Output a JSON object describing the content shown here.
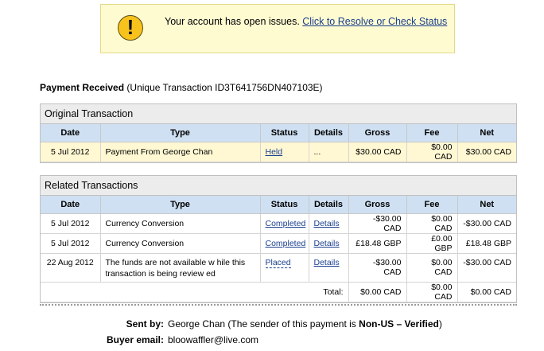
{
  "alert": {
    "icon": "exclamation-icon",
    "message": "Your account has open issues.",
    "link": "Click to Resolve or Check Status"
  },
  "heading": {
    "label": "Payment Received",
    "transaction": "(Unique Transaction ID3T641756DN407103E)"
  },
  "columns": [
    "Date",
    "Type",
    "Status",
    "Details",
    "Gross",
    "Fee",
    "Net"
  ],
  "original": {
    "title": "Original Transaction",
    "row": {
      "date": "5 Jul 2012",
      "type": "Payment From George Chan",
      "status": "Held",
      "details": "...",
      "gross": "$30.00 CAD",
      "fee": "$0.00 CAD",
      "net": "$30.00 CAD"
    }
  },
  "related": {
    "title": "Related Transactions",
    "rows": [
      {
        "date": "5 Jul 2012",
        "type": "Currency Conversion",
        "status": "Completed",
        "details": "Details",
        "gross": "-$30.00 CAD",
        "fee": "$0.00 CAD",
        "net": "-$30.00 CAD"
      },
      {
        "date": "5 Jul 2012",
        "type": "Currency Conversion",
        "status": "Completed",
        "details": "Details",
        "gross": "£18.48 GBP",
        "fee": "£0.00 GBP",
        "net": "£18.48 GBP"
      },
      {
        "date": "22 Aug 2012",
        "type_line1": "The funds are not available w hile this",
        "type_line2": "transaction is being review ed",
        "status": "Placed",
        "details": "Details",
        "gross": "-$30.00 CAD",
        "fee": "$0.00 CAD",
        "net": "-$30.00 CAD"
      }
    ],
    "total": {
      "label": "Total:",
      "gross": "$0.00 CAD",
      "fee": "$0.00 CAD",
      "net": "$0.00 CAD"
    }
  },
  "sender": {
    "sent_by_label": "Sent by:",
    "sent_by_name": "George Chan",
    "sent_by_note_pre": "(The sender of this payment is",
    "sent_by_status": "Non-US – Verified",
    "sent_by_note_post": ")",
    "buyer_email_label": "Buyer email:",
    "buyer_email": "bloowaffler@live.com"
  }
}
